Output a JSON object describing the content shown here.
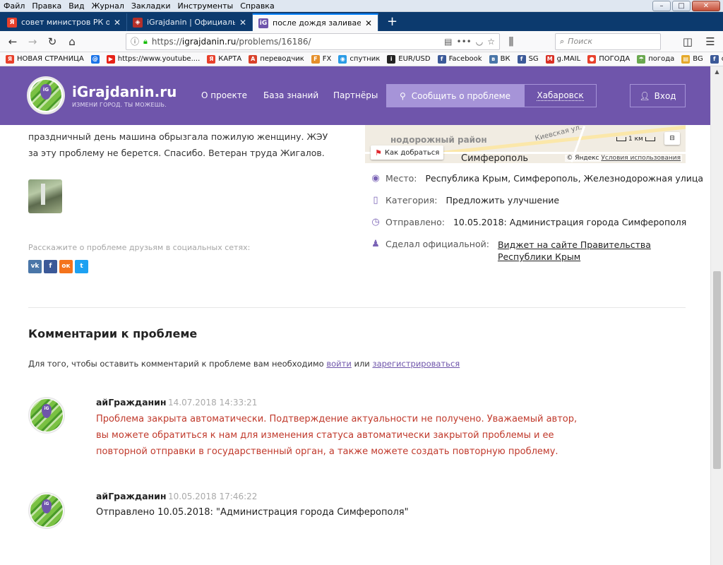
{
  "window": {
    "menu": [
      "Файл",
      "Правка",
      "Вид",
      "Журнал",
      "Закладки",
      "Инструменты",
      "Справка"
    ],
    "controls": {
      "minimize": "–",
      "maximize": "□",
      "close": "✕"
    }
  },
  "tabs": [
    {
      "title": "совет министров РК обращен",
      "icon": "yandex-icon",
      "active": false
    },
    {
      "title": "iGrajdanin | Официальный пор",
      "icon": "crimea-shield-icon",
      "active": false
    },
    {
      "title": "после дождя заливает водой т",
      "icon": "igrajdanin-icon",
      "active": true
    }
  ],
  "navbar": {
    "url_prefix": "https://",
    "url_host": "igrajdanin.ru",
    "url_path": "/problems/16186/",
    "search_placeholder": "Поиск"
  },
  "bookmarks": [
    {
      "label": "НОВАЯ СТРАНИЦА",
      "icon": "yandex-icon",
      "color": "#e8402b",
      "glyph": "Я"
    },
    {
      "label": "",
      "icon": "mail-at-icon",
      "color": "#1a73e8",
      "glyph": "@"
    },
    {
      "label": "https://www.youtube....",
      "icon": "youtube-icon",
      "color": "#e62117",
      "glyph": "▶"
    },
    {
      "label": "КАРТА",
      "icon": "yandex-icon",
      "color": "#e8402b",
      "glyph": "Я"
    },
    {
      "label": "переводчик",
      "icon": "translate-icon",
      "color": "#d9412a",
      "glyph": "A"
    },
    {
      "label": "FX",
      "icon": "fx-icon",
      "color": "#e58f2a",
      "glyph": "F"
    },
    {
      "label": "спутник",
      "icon": "satellite-icon",
      "color": "#2a9be5",
      "glyph": "◉"
    },
    {
      "label": "EUR/USD",
      "icon": "investing-icon",
      "color": "#222222",
      "glyph": "i"
    },
    {
      "label": "Facebook",
      "icon": "facebook-icon",
      "color": "#3b5998",
      "glyph": "f"
    },
    {
      "label": "ВК",
      "icon": "vk-icon",
      "color": "#4a76a8",
      "glyph": "в"
    },
    {
      "label": "SG",
      "icon": "facebook-icon",
      "color": "#3b5998",
      "glyph": "f"
    },
    {
      "label": "g.MAIL",
      "icon": "gmail-icon",
      "color": "#d93025",
      "glyph": "M"
    },
    {
      "label": "ПОГОДА",
      "icon": "weather-icon",
      "color": "#e8402b",
      "glyph": "●"
    },
    {
      "label": "погода",
      "icon": "umbrella-icon",
      "color": "#6aa84f",
      "glyph": "☂"
    },
    {
      "label": "BG",
      "icon": "folder-icon",
      "color": "#e5a92a",
      "glyph": "▤"
    },
    {
      "label": "стр В",
      "icon": "facebook-icon",
      "color": "#3b5998",
      "glyph": "f"
    }
  ],
  "site": {
    "brand": "iGrajdanin.ru",
    "tagline": "ИЗМЕНИ ГОРОД. ТЫ МОЖЕШЬ.",
    "nav": [
      "О проекте",
      "База знаний",
      "Партнёры"
    ],
    "report_button": "Сообщить о проблеме",
    "city": "Хабаровск",
    "login": "Вход"
  },
  "problem": {
    "description": "праздничный день машина обрызгала пожилую женщину. ЖЭУ за эту проблему не берется. Спасибо. Ветеран труда Жигалов.",
    "share_label": "Расскажите о проблеме друзьям в социальных сетях:",
    "social": [
      {
        "name": "vk",
        "glyph": "vk",
        "color": "#4a76a8"
      },
      {
        "name": "facebook",
        "glyph": "f",
        "color": "#3b5998"
      },
      {
        "name": "odnoklassniki",
        "glyph": "ок",
        "color": "#f4731c"
      },
      {
        "name": "twitter",
        "glyph": "t",
        "color": "#1da1f2"
      }
    ],
    "map": {
      "district_label": "нодорожный район",
      "street_label": "Киевская ул.",
      "city_label": "Симферополь",
      "route_button": "Как добраться",
      "scale": "1 км",
      "copyright": "© Яндекс",
      "terms": "Условия использования"
    },
    "meta": {
      "place_label": "Место:",
      "place_value": "Республика Крым, Симферополь, Железнодорожная улица",
      "category_label": "Категория:",
      "category_value": "Предложить улучшение",
      "sent_label": "Отправлено:",
      "sent_value": "10.05.2018: Администрация города Симферополя",
      "official_label": "Сделал официальной:",
      "official_value": "Виджет на сайте Правительства Республики Крым"
    }
  },
  "comments": {
    "title": "Комментарии к проблеме",
    "note_prefix": "Для того, чтобы оставить комментарий к проблеме вам необходимо",
    "note_login": "войти",
    "note_or": "или",
    "note_register": "зарегистрироваться",
    "items": [
      {
        "author": "айГражданин",
        "date": "14.07.2018 14:33:21",
        "text": "Проблема закрыта автоматически. Подтверждение актуальности не получено. Уважаемый автор, вы можете обратиться к нам для изменения статуса автоматически закрытой проблемы и ее повторной отправки в государственный орган, а также можете создать повторную проблему.",
        "auto": true
      },
      {
        "author": "айГражданин",
        "date": "10.05.2018 17:46:22",
        "text": "Отправлено 10.05.2018: \"Администрация города Симферополя\"",
        "auto": false
      }
    ]
  }
}
